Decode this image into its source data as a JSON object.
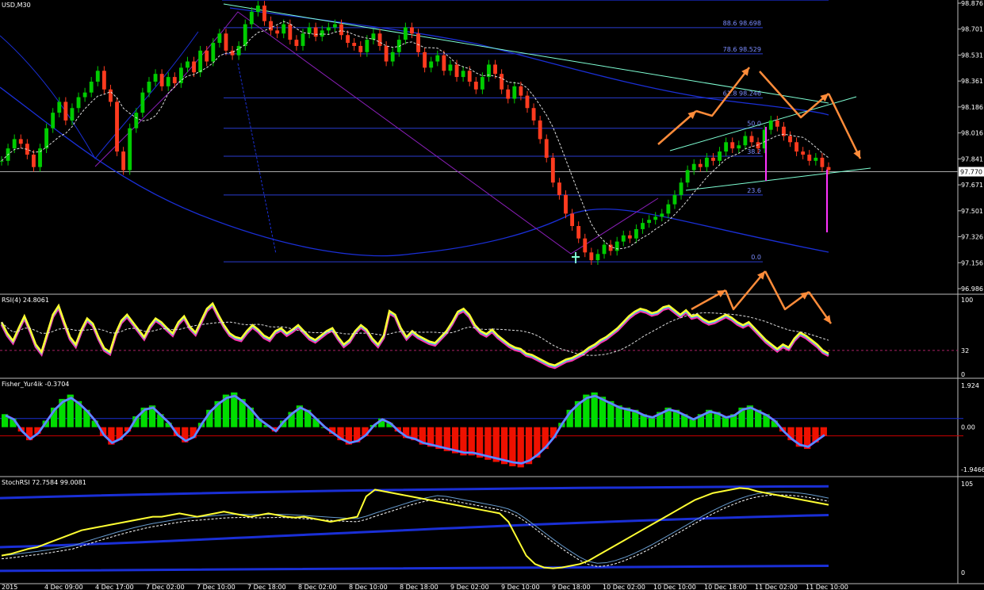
{
  "window": {
    "title": "USD,M30"
  },
  "colors": {
    "background": "#000000",
    "bull": "#00cc00",
    "bear": "#ff3b1f",
    "fib": "#2a3ccf",
    "trend": "#7fffd4",
    "ma_blue": "#1a2fd6",
    "annotation": "#ff8c3a",
    "spike": "#ff33ff",
    "rsi_main": "#ffff33",
    "rsi_under": "#ff33aa",
    "hist_up": "#00dd00",
    "hist_down": "#ee1100",
    "fisher_line": "#33bbff"
  },
  "chart_data": [
    {
      "type": "candlestick",
      "title": "USD,M30",
      "current_price": "97.770",
      "ylim": [
        96.986,
        98.876
      ],
      "y_ticks": [
        "98.876",
        "98.701",
        "98.531",
        "98.361",
        "98.186",
        "98.016",
        "97.841",
        "97.671",
        "97.501",
        "97.326",
        "97.156",
        "96.986"
      ],
      "fib_levels": [
        {
          "label": "88.6 98.698",
          "value": 98.698
        },
        {
          "label": "78.6 98.529",
          "value": 98.529
        },
        {
          "label": "61.8 98.246",
          "value": 98.246
        },
        {
          "label": "50.0",
          "value": 98.05
        },
        {
          "label": "38.2",
          "value": 97.87
        },
        {
          "label": "23.6",
          "value": 97.62
        },
        {
          "label": "0.0",
          "value": 97.19
        }
      ],
      "close_series": [
        97.84,
        97.92,
        97.98,
        97.95,
        97.88,
        97.8,
        97.92,
        98.05,
        98.15,
        98.22,
        98.1,
        98.18,
        98.25,
        98.28,
        98.35,
        98.42,
        98.3,
        98.22,
        97.9,
        97.78,
        98.05,
        98.15,
        98.28,
        98.35,
        98.4,
        98.32,
        98.38,
        98.34,
        98.44,
        98.48,
        98.41,
        98.55,
        98.48,
        98.6,
        98.66,
        98.55,
        98.52,
        98.58,
        98.72,
        98.8,
        98.84,
        98.74,
        98.68,
        98.66,
        98.72,
        98.62,
        98.58,
        98.66,
        98.7,
        98.64,
        98.68,
        98.7,
        98.72,
        98.65,
        98.6,
        98.58,
        98.54,
        98.62,
        98.66,
        98.58,
        98.48,
        98.54,
        98.62,
        98.7,
        98.66,
        98.54,
        98.44,
        98.48,
        98.52,
        98.42,
        98.46,
        98.38,
        98.42,
        98.35,
        98.3,
        98.38,
        98.46,
        98.4,
        98.3,
        98.24,
        98.32,
        98.26,
        98.18,
        98.1,
        97.98,
        97.86,
        97.7,
        97.62,
        97.5,
        97.42,
        97.34,
        97.25,
        97.2,
        97.24,
        97.3,
        97.26,
        97.32,
        97.36,
        97.34,
        97.4,
        97.44,
        97.46,
        97.48,
        97.5,
        97.56,
        97.62,
        97.7,
        97.78,
        97.82,
        97.8,
        97.86,
        97.84,
        97.9,
        97.96,
        97.92,
        97.94,
        98.0,
        97.96,
        97.92,
        98.04,
        98.1,
        98.06,
        98.0,
        97.96,
        97.9,
        97.88,
        97.84,
        97.86,
        97.8,
        97.78
      ],
      "x_ticks": [
        "2015",
        "4 Dec 09:00",
        "4 Dec 17:00",
        "7 Dec 02:00",
        "7 Dec 10:00",
        "7 Dec 18:00",
        "8 Dec 02:00",
        "8 Dec 10:00",
        "8 Dec 18:00",
        "9 Dec 02:00",
        "9 Dec 10:00",
        "9 Dec 18:00",
        "10 Dec 02:00",
        "10 Dec 10:00",
        "10 Dec 18:00",
        "11 Dec 02:00",
        "11 Dec 10:00"
      ]
    },
    {
      "type": "line",
      "title": "RSI(4) 24.8061",
      "ylim": [
        0,
        100
      ],
      "y_ticks": [
        "100",
        "32",
        "0"
      ],
      "level": 32,
      "values": [
        70,
        55,
        45,
        62,
        78,
        60,
        40,
        30,
        55,
        80,
        92,
        70,
        50,
        40,
        60,
        75,
        68,
        50,
        35,
        30,
        55,
        72,
        80,
        70,
        60,
        50,
        65,
        75,
        70,
        62,
        55,
        70,
        78,
        64,
        56,
        72,
        88,
        95,
        80,
        66,
        55,
        50,
        48,
        58,
        66,
        60,
        52,
        48,
        58,
        62,
        55,
        60,
        66,
        58,
        50,
        46,
        52,
        58,
        62,
        50,
        40,
        46,
        58,
        66,
        60,
        48,
        40,
        52,
        85,
        80,
        62,
        50,
        58,
        52,
        48,
        44,
        42,
        50,
        58,
        70,
        84,
        88,
        80,
        66,
        58,
        54,
        60,
        52,
        46,
        40,
        36,
        34,
        28,
        26,
        22,
        18,
        14,
        12,
        16,
        20,
        22,
        26,
        30,
        36,
        40,
        46,
        50,
        56,
        62,
        70,
        78,
        84,
        88,
        86,
        82,
        84,
        90,
        92,
        86,
        80,
        86,
        78,
        80,
        74,
        70,
        72,
        76,
        80,
        76,
        70,
        66,
        70,
        62,
        54,
        46,
        40,
        34,
        40,
        36,
        48,
        56,
        52,
        46,
        40,
        32,
        28
      ]
    },
    {
      "type": "bar",
      "title": "Fisher_Yur4ik -0.3704",
      "ylim": [
        -1.9466,
        1.924
      ],
      "y_ticks": [
        "1.924",
        "0.00",
        "-1.9466"
      ],
      "values": [
        0.6,
        0.4,
        -0.2,
        -0.6,
        -0.3,
        0.3,
        0.9,
        1.3,
        1.5,
        1.2,
        0.8,
        0.3,
        -0.4,
        -0.8,
        -0.6,
        -0.2,
        0.5,
        0.9,
        1.0,
        0.6,
        0.2,
        -0.4,
        -0.7,
        -0.5,
        0.2,
        0.8,
        1.2,
        1.5,
        1.6,
        1.3,
        0.9,
        0.4,
        0.1,
        -0.2,
        0.3,
        0.7,
        1.0,
        0.8,
        0.4,
        0.0,
        -0.3,
        -0.6,
        -0.8,
        -0.7,
        -0.4,
        0.1,
        0.4,
        0.2,
        -0.2,
        -0.5,
        -0.6,
        -0.8,
        -0.9,
        -1.0,
        -1.1,
        -1.2,
        -1.3,
        -1.3,
        -1.4,
        -1.5,
        -1.6,
        -1.7,
        -1.8,
        -1.85,
        -1.7,
        -1.4,
        -1.0,
        -0.5,
        0.2,
        0.8,
        1.2,
        1.5,
        1.6,
        1.4,
        1.2,
        1.0,
        0.9,
        0.8,
        0.6,
        0.5,
        0.7,
        0.9,
        0.8,
        0.6,
        0.4,
        0.6,
        0.8,
        0.7,
        0.5,
        0.6,
        0.9,
        1.0,
        0.8,
        0.6,
        0.3,
        -0.2,
        -0.6,
        -0.9,
        -1.0,
        -0.7,
        -0.4
      ]
    },
    {
      "type": "line",
      "title": "StochRSI 72.7584 99.0081",
      "ylim": [
        0,
        105
      ],
      "y_ticks": [
        "105",
        "0"
      ],
      "values": [
        20,
        22,
        25,
        28,
        30,
        34,
        38,
        42,
        46,
        50,
        52,
        54,
        56,
        58,
        60,
        62,
        64,
        66,
        66,
        68,
        70,
        68,
        66,
        68,
        70,
        72,
        70,
        68,
        66,
        68,
        70,
        68,
        66,
        65,
        66,
        64,
        62,
        60,
        62,
        64,
        66,
        90,
        98,
        96,
        94,
        92,
        90,
        88,
        86,
        84,
        82,
        80,
        78,
        76,
        74,
        72,
        70,
        60,
        40,
        20,
        10,
        6,
        5,
        6,
        8,
        10,
        14,
        20,
        26,
        32,
        38,
        44,
        50,
        56,
        62,
        68,
        74,
        80,
        86,
        90,
        94,
        96,
        98,
        100,
        99,
        96,
        94,
        92,
        90,
        88,
        86,
        84,
        82,
        80
      ]
    }
  ]
}
